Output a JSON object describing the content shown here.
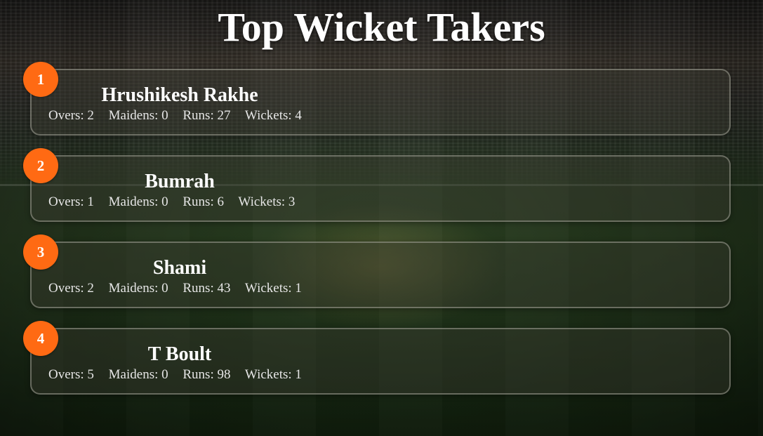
{
  "title": "Top Wicket Takers",
  "colors": {
    "badge": "#ff6a13",
    "text": "#ffffff"
  },
  "players": [
    {
      "rank": "1",
      "name": "Hrushikesh Rakhe",
      "overs": "Overs: 2",
      "maidens": "Maidens: 0",
      "runs": "Runs: 27",
      "wickets": "Wickets: 4"
    },
    {
      "rank": "2",
      "name": "Bumrah",
      "overs": "Overs: 1",
      "maidens": "Maidens: 0",
      "runs": "Runs: 6",
      "wickets": "Wickets: 3"
    },
    {
      "rank": "3",
      "name": "Shami",
      "overs": "Overs: 2",
      "maidens": "Maidens: 0",
      "runs": "Runs: 43",
      "wickets": "Wickets: 1"
    },
    {
      "rank": "4",
      "name": "T Boult",
      "overs": "Overs: 5",
      "maidens": "Maidens: 0",
      "runs": "Runs: 98",
      "wickets": "Wickets: 1"
    }
  ]
}
